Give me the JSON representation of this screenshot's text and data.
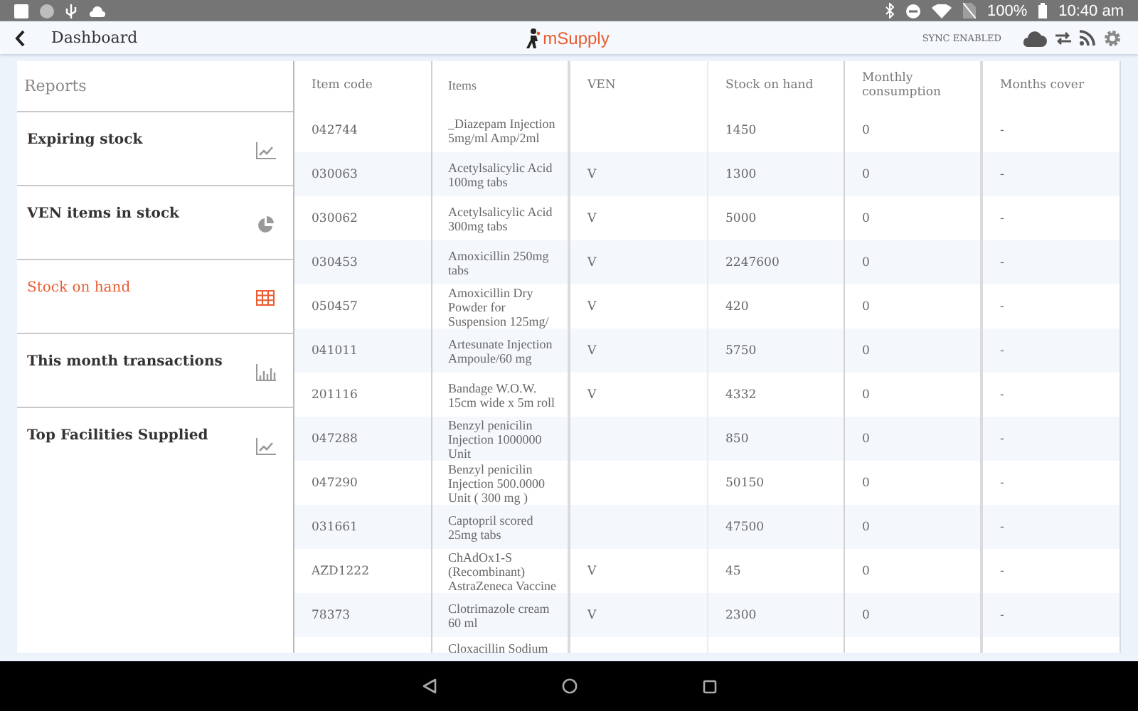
{
  "status_bar": {
    "battery": "100%",
    "time": "10:40 am"
  },
  "header": {
    "title": "Dashboard",
    "logo": "mSupply",
    "sync": "SYNC ENABLED"
  },
  "reports": {
    "title": "Reports",
    "items": [
      {
        "label": "Expiring stock",
        "kind": "line",
        "selected": false
      },
      {
        "label": "VEN items in stock",
        "kind": "pie",
        "selected": false
      },
      {
        "label": "Stock on hand",
        "kind": "table",
        "selected": true
      },
      {
        "label": "This month transactions",
        "kind": "bar",
        "selected": false
      },
      {
        "label": "Top Facilities Supplied",
        "kind": "line",
        "selected": false
      }
    ]
  },
  "table": {
    "columns": [
      "Item code",
      "Items",
      "VEN",
      "Stock on hand",
      "Monthly consumption",
      "Months cover"
    ],
    "rows": [
      [
        "042744",
        "_Diazepam Injection 5mg/ml Amp/2ml",
        "",
        "1450",
        "0",
        "-"
      ],
      [
        "030063",
        "Acetylsalicylic Acid 100mg tabs",
        "V",
        "1300",
        "0",
        "-"
      ],
      [
        "030062",
        "Acetylsalicylic Acid 300mg tabs",
        "V",
        "5000",
        "0",
        "-"
      ],
      [
        "030453",
        "Amoxicillin 250mg tabs",
        "V",
        "2247600",
        "0",
        "-"
      ],
      [
        "050457",
        "Amoxicillin Dry Powder for Suspension 125mg/",
        "V",
        "420",
        "0",
        "-"
      ],
      [
        "041011",
        "Artesunate Injection Ampoule/60 mg",
        "V",
        "5750",
        "0",
        "-"
      ],
      [
        "201116",
        "Bandage W.O.W. 15cm wide x 5m roll",
        "V",
        "4332",
        "0",
        "-"
      ],
      [
        "047288",
        "Benzyl penicilin Injection 1000000 Unit",
        "",
        "850",
        "0",
        "-"
      ],
      [
        "047290",
        "Benzyl penicilin Injection 500.0000 Unit ( 300 mg )",
        "",
        "50150",
        "0",
        "-"
      ],
      [
        "031661",
        "Captopril scored 25mg tabs",
        "",
        "47500",
        "0",
        "-"
      ],
      [
        "AZD1222",
        "ChAdOx1-S (Recombinant) AstraZeneca Vaccine",
        "V",
        "45",
        "0",
        "-"
      ],
      [
        "78373",
        "Clotrimazole cream 60 ml",
        "V",
        "2300",
        "0",
        "-"
      ],
      [
        "",
        "Cloxacillin Sodium",
        "",
        "",
        "",
        ""
      ]
    ]
  }
}
